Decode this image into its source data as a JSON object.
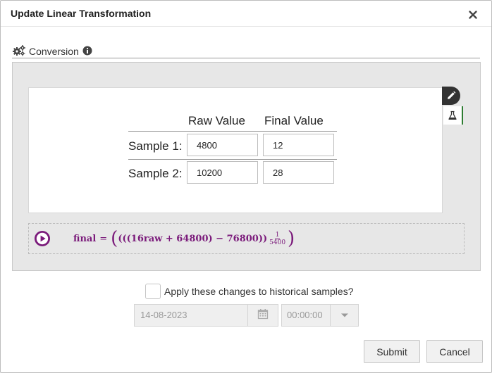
{
  "dialog": {
    "title": "Update Linear Transformation"
  },
  "section": {
    "label": "Conversion",
    "icon": "gears-icon",
    "info_icon": "info-circle-icon"
  },
  "table": {
    "columns": [
      "Raw Value",
      "Final Value"
    ],
    "rows": [
      {
        "label": "Sample 1:",
        "raw": "4800",
        "final": "12"
      },
      {
        "label": "Sample 2:",
        "raw": "10200",
        "final": "28"
      }
    ]
  },
  "tools": [
    "pencil-icon",
    "flask-icon"
  ],
  "formula": {
    "lhs": "final",
    "eq": "=",
    "body": "(((16raw + 64800) − 76800))",
    "frac_num": "1",
    "frac_den": "5400"
  },
  "historical": {
    "label": "Apply these changes to historical samples?",
    "checked": false,
    "date_value": "14-08-2023",
    "time_value": "00:00:00"
  },
  "buttons": {
    "submit": "Submit",
    "cancel": "Cancel"
  },
  "colors": {
    "formula": "#7b1b7b",
    "accent_border": "#2e7d32",
    "panel_bg": "#e7e7e7"
  }
}
